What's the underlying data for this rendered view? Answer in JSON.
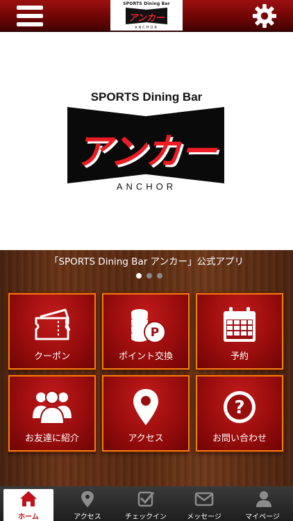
{
  "header": {
    "logo_top": "SPORTS Dining Bar",
    "logo_kana": "アンカー",
    "logo_bottom": "ANCHOR",
    "menu_icon": "hamburger-menu-icon",
    "settings_icon": "gear-icon"
  },
  "hero": {
    "subtitle": "SPORTS Dining Bar",
    "kana": "アンカー",
    "english": "ANCHOR"
  },
  "app_title": "「SPORTS Dining Bar アンカー」公式アプリ",
  "carousel": {
    "pages": 3,
    "active_index": 0
  },
  "tiles": [
    {
      "label": "クーポン",
      "icon": "ticket-icon"
    },
    {
      "label": "ポイント交換",
      "icon": "coins-icon"
    },
    {
      "label": "予約",
      "icon": "calendar-icon"
    },
    {
      "label": "お友達に紹介",
      "icon": "group-icon"
    },
    {
      "label": "アクセス",
      "icon": "map-pin-icon"
    },
    {
      "label": "お問い合わせ",
      "icon": "question-icon"
    }
  ],
  "tabs": [
    {
      "label": "ホーム",
      "icon": "home-icon",
      "active": true
    },
    {
      "label": "アクセス",
      "icon": "map-pin-icon",
      "active": false
    },
    {
      "label": "チェックイン",
      "icon": "checkbox-icon",
      "active": false
    },
    {
      "label": "メッセージ",
      "icon": "envelope-icon",
      "active": false
    },
    {
      "label": "マイページ",
      "icon": "user-icon",
      "active": false
    }
  ],
  "colors": {
    "header_red": "#8b0b0b",
    "tile_red": "#a80f0f",
    "tile_border": "#f07f10",
    "logo_red": "#ec1c24",
    "tab_active": "#c0121a"
  }
}
